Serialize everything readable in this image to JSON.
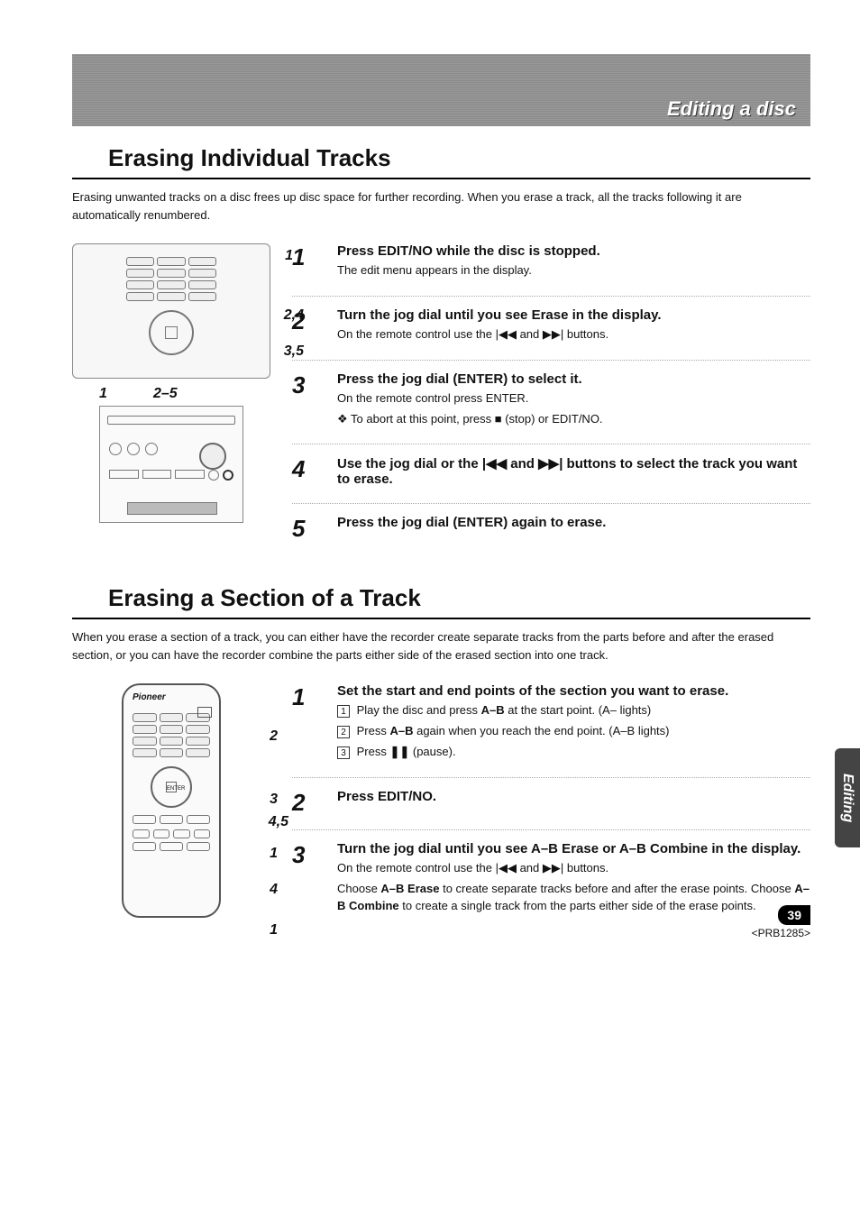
{
  "header": {
    "band_title": "Editing a disc"
  },
  "side_tab": "Editing",
  "page_number": "39",
  "doc_code": "<PRB1285>",
  "section1": {
    "title": "Erasing Individual Tracks",
    "intro": "Erasing unwanted tracks on a disc frees up disc space for further recording. When you erase a track, all the tracks following it are automatically renumbered.",
    "diagram1_callouts": [
      "1",
      "2,4",
      "3,5"
    ],
    "diagram2_callouts": [
      "1",
      "2–5"
    ],
    "steps": [
      {
        "num": "1",
        "title": "Press EDIT/NO while the disc is stopped.",
        "lines": [
          "The edit menu appears in the display."
        ]
      },
      {
        "num": "2",
        "title": "Turn the jog dial until you see Erase in the display.",
        "lines": [
          "On the remote control use the |◀◀ and ▶▶| buttons."
        ]
      },
      {
        "num": "3",
        "title": "Press the jog dial (ENTER) to select it.",
        "lines": [
          "On the remote control press ENTER.",
          "❖  To abort at this point, press ■ (stop) or EDIT/NO."
        ]
      },
      {
        "num": "4",
        "title": "Use the jog dial or the |◀◀ and ▶▶| buttons to select the track you want to erase.",
        "lines": []
      },
      {
        "num": "5",
        "title": "Press the jog dial (ENTER) again to erase.",
        "lines": []
      }
    ]
  },
  "section2": {
    "title": "Erasing a Section of a Track",
    "intro": "When you erase a section of a track, you can either have the recorder create separate tracks from the parts before and after the erased section, or you can have the recorder combine the parts either side of the erased section into one track.",
    "remote_brand": "Pioneer",
    "diagram_callouts": [
      "2",
      "3",
      "4,5",
      "1",
      "4",
      "1"
    ],
    "steps": [
      {
        "num": "1",
        "title": "Set the start and end points of the section you want to erase.",
        "sublines": [
          {
            "n": "1",
            "text_before": "Play the disc and press ",
            "bold": "A–B",
            "text_after": " at the start point. (A– lights)"
          },
          {
            "n": "2",
            "text_before": "Press ",
            "bold": "A–B",
            "text_after": " again when you reach the end point. (A–B lights)"
          },
          {
            "n": "3",
            "text_before": "Press ",
            "bold": "❚❚",
            "text_after": " (pause)."
          }
        ]
      },
      {
        "num": "2",
        "title": "Press EDIT/NO.",
        "lines": []
      },
      {
        "num": "3",
        "title": "Turn the jog dial until you see A–B Erase or A–B Combine in the display.",
        "lines": [
          "On the remote control use the |◀◀ and ▶▶| buttons."
        ],
        "para": {
          "pre": "Choose ",
          "b1": "A–B Erase",
          "mid": " to create separate tracks before and after the erase points. Choose ",
          "b2": "A–B Combine",
          "post": " to create a single track from the parts either side of the erase points."
        }
      }
    ]
  }
}
